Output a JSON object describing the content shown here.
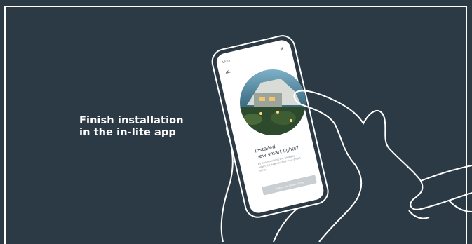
{
  "caption": {
    "line1": "Finish installation",
    "line2": "in the in-lite app"
  },
  "phone": {
    "status_time": "19:03",
    "status_icons": "▮▮",
    "headline_line1": "Installed",
    "headline_line2": "new smart lights?",
    "body_line1": "By synchronizing the gateway",
    "body_line2": "again the app can find your smart",
    "body_line3": "lights.",
    "button_label": "Search for smart lights"
  },
  "colors": {
    "background": "#2c3a45",
    "outline": "#ffffff",
    "button": "#c9ced2"
  }
}
